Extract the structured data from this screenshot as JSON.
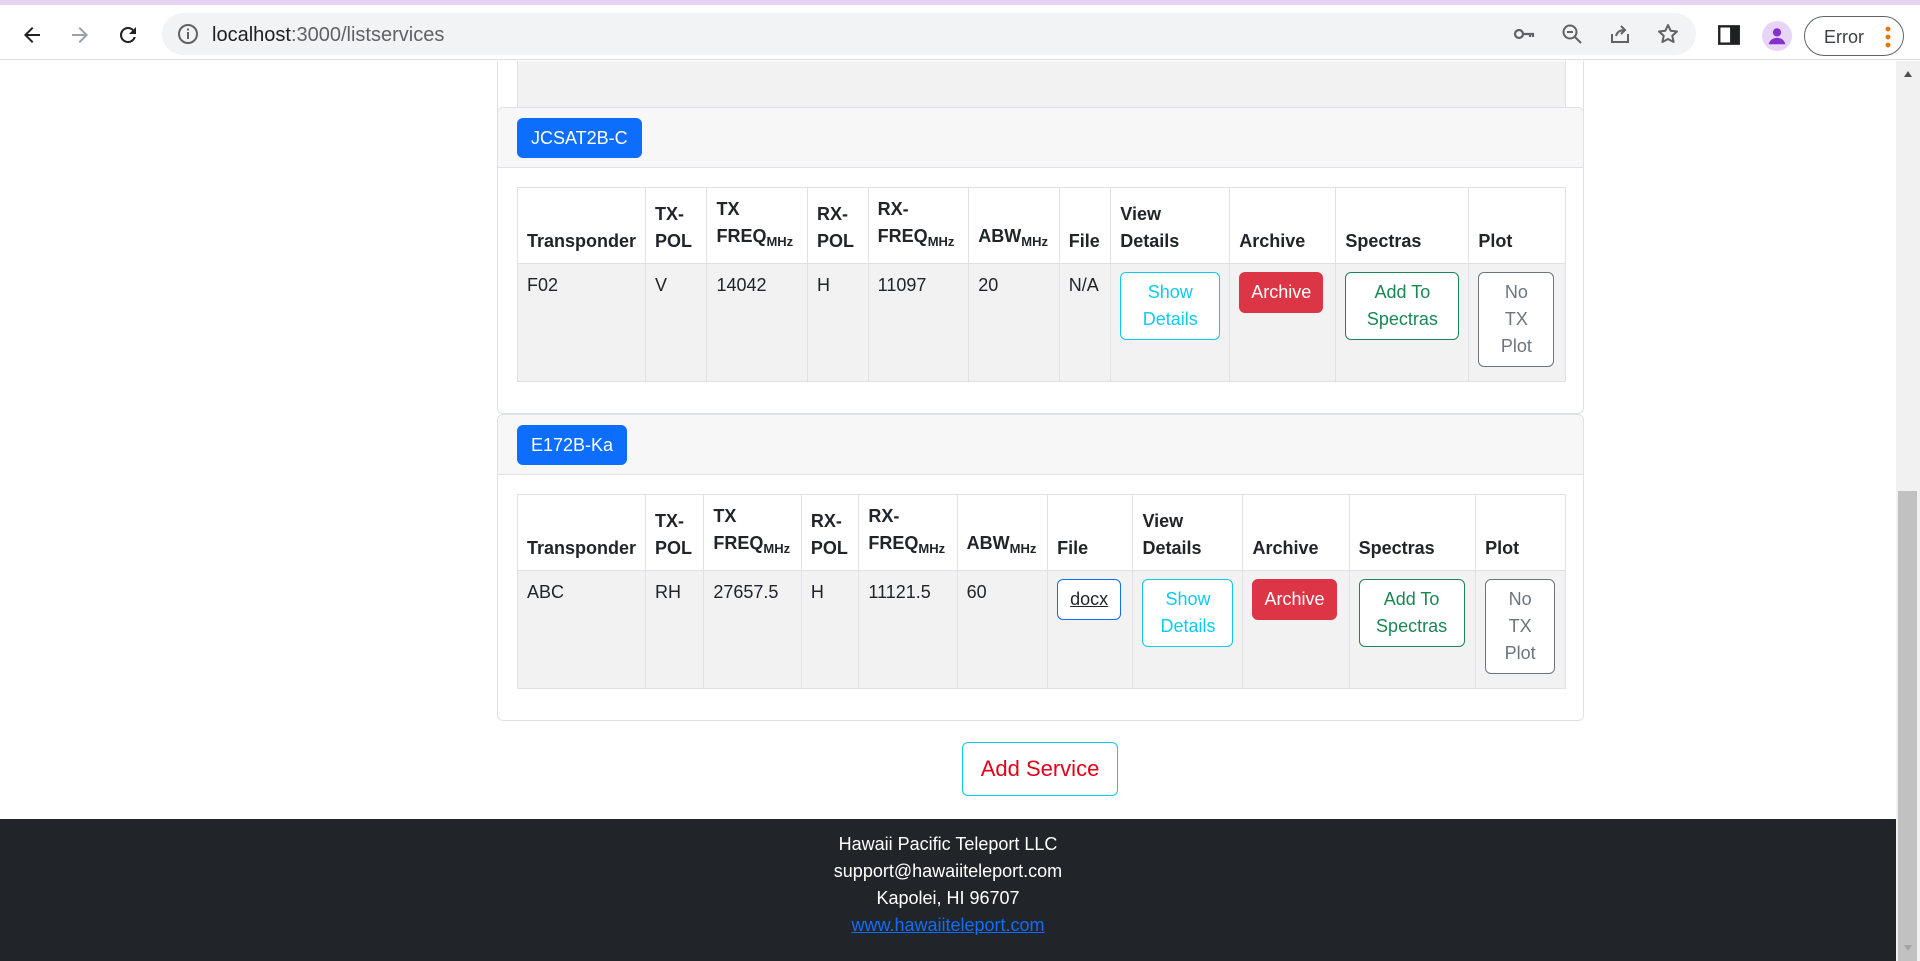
{
  "browser": {
    "url_host": "localhost",
    "url_path": ":3000/listservices",
    "profile_status": "Error"
  },
  "tables": {
    "headers": {
      "transponder": "Transponder",
      "tx_pol": [
        "TX-",
        "POL"
      ],
      "tx_freq": "TX FREQ",
      "rx_pol": [
        "RX-",
        "POL"
      ],
      "rx_freq": [
        "RX-",
        "FREQ"
      ],
      "abw": "ABW",
      "unit": "MHz",
      "file": "File",
      "view_details": [
        "View",
        "Details"
      ],
      "archive": "Archive",
      "spectras": "Spectras",
      "plot": "Plot"
    }
  },
  "services": [
    {
      "satellite": "JCSAT2B-C",
      "row": {
        "transponder": "F02",
        "tx_pol": "V",
        "tx_freq": "14042",
        "rx_pol": "H",
        "rx_freq": "11097",
        "abw": "20",
        "file": "N/A"
      },
      "buttons": {
        "show_details": [
          "Show",
          "Details"
        ],
        "archive": "Archive",
        "add_spectras": [
          "Add To",
          "Spectras"
        ],
        "plot": [
          "No",
          "TX",
          "Plot"
        ]
      }
    },
    {
      "satellite": "E172B-Ka",
      "row": {
        "transponder": "ABC",
        "tx_pol": "RH",
        "tx_freq": "27657.5",
        "rx_pol": "H",
        "rx_freq": "11121.5",
        "abw": "60",
        "file": "docx"
      },
      "buttons": {
        "show_details": [
          "Show",
          "Details"
        ],
        "archive": "Archive",
        "add_spectras": [
          "Add To",
          "Spectras"
        ],
        "plot": [
          "No",
          "TX",
          "Plot"
        ]
      }
    }
  ],
  "add_service_label": "Add Service",
  "footer": {
    "company": "Hawaii Pacific Teleport LLC",
    "email": "support@hawaiiteleport.com",
    "address": "Kapolei, HI 96707",
    "website": "www.hawaiiteleport.com"
  },
  "colors": {
    "primary": "#0d6efd",
    "danger": "#dc3545",
    "success": "#198754",
    "info": "#0dcaf0",
    "footer_bg": "#212529",
    "add_service_text": "#e3001b"
  }
}
